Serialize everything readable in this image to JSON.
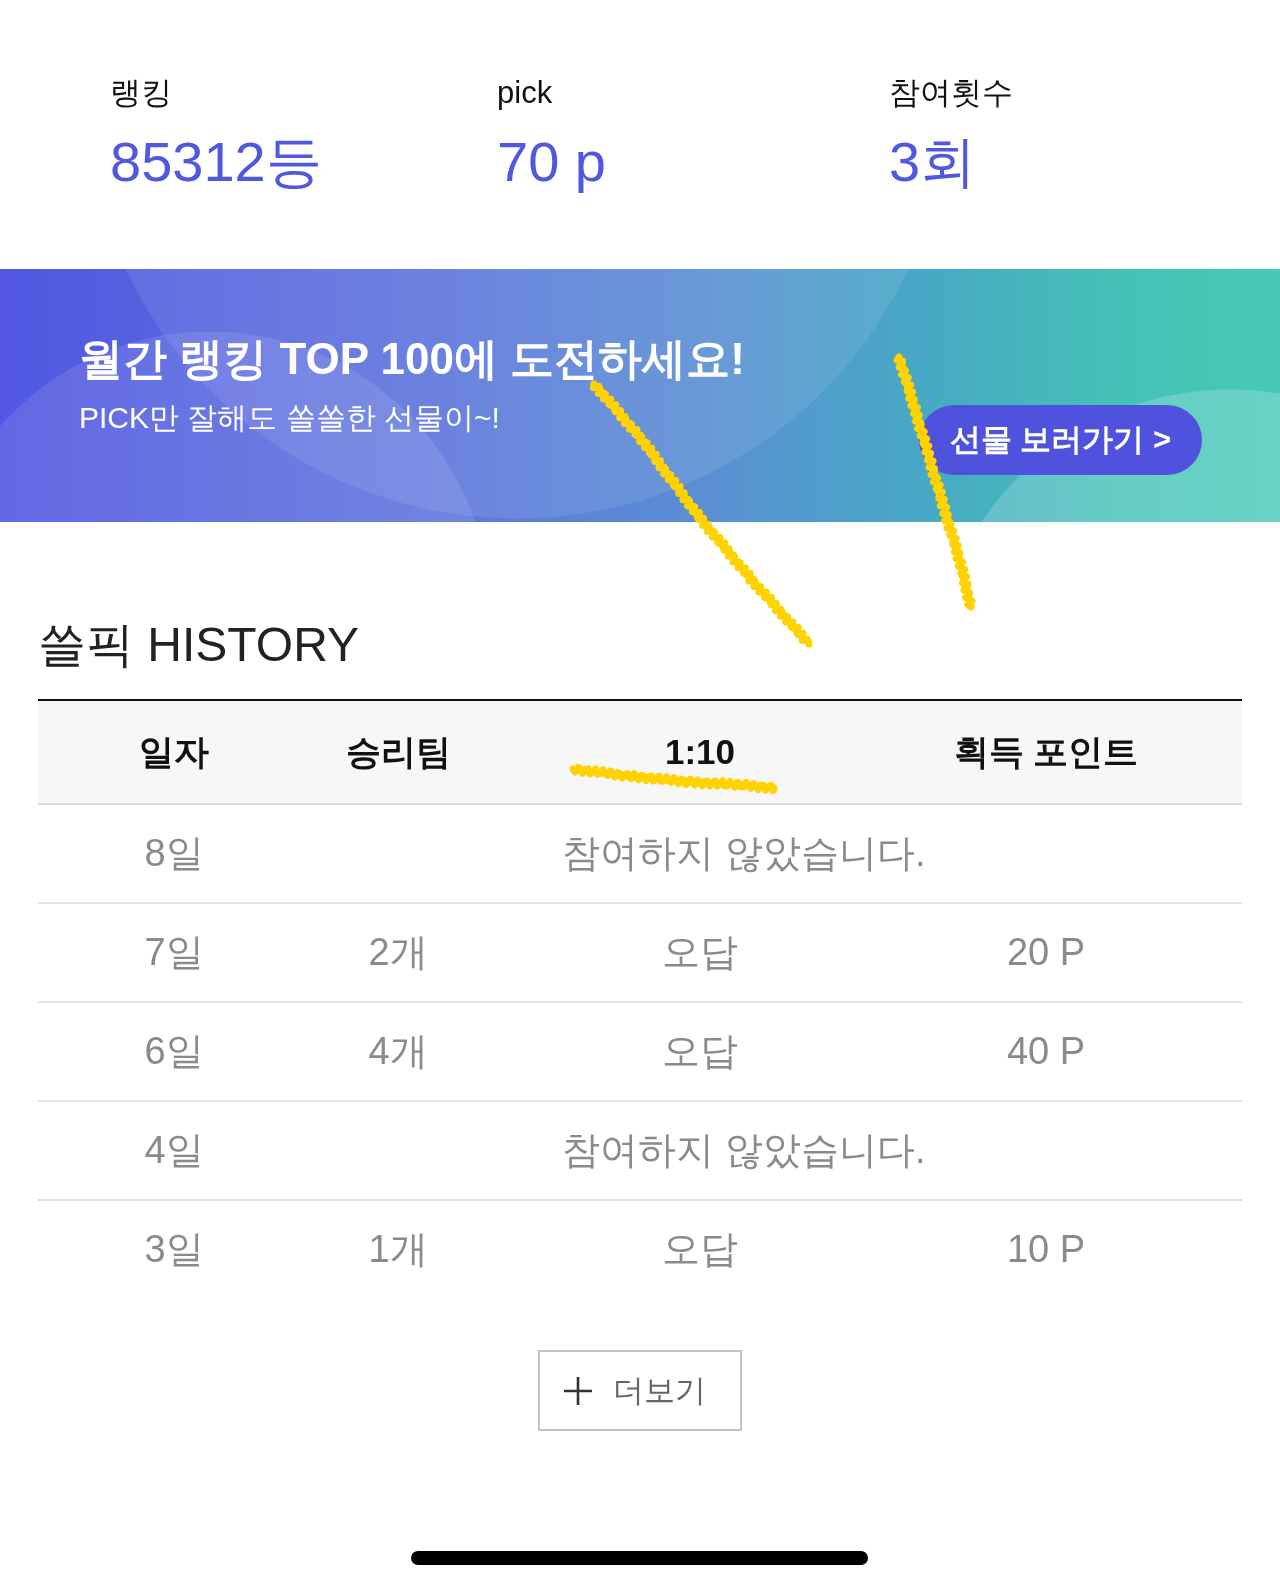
{
  "stats": [
    {
      "label": "랭킹",
      "value": "85312등"
    },
    {
      "label": "pick",
      "value": "70 p"
    },
    {
      "label": "참여횟수",
      "value": "3회"
    }
  ],
  "banner": {
    "title": "월간 랭킹 TOP 100에 도전하세요!",
    "subtitle": "PICK만 잘해도 쏠쏠한 선물이~!",
    "button": "선물 보러가기 >"
  },
  "history": {
    "title": "쓸픽 HISTORY",
    "columns": [
      "일자",
      "승리팀",
      "1:10",
      "획득 포인트"
    ],
    "rows": [
      {
        "kind": "absent",
        "date": "8일",
        "message": "참여하지 않았습니다."
      },
      {
        "kind": "played",
        "date": "7일",
        "winning_team": "2개",
        "result": "오답",
        "points": "20 P"
      },
      {
        "kind": "played",
        "date": "6일",
        "winning_team": "4개",
        "result": "오답",
        "points": "40 P"
      },
      {
        "kind": "absent",
        "date": "4일",
        "message": "참여하지 않았습니다."
      },
      {
        "kind": "played",
        "date": "3일",
        "winning_team": "1개",
        "result": "오답",
        "points": "10 P"
      }
    ],
    "more_button": "더보기"
  }
}
